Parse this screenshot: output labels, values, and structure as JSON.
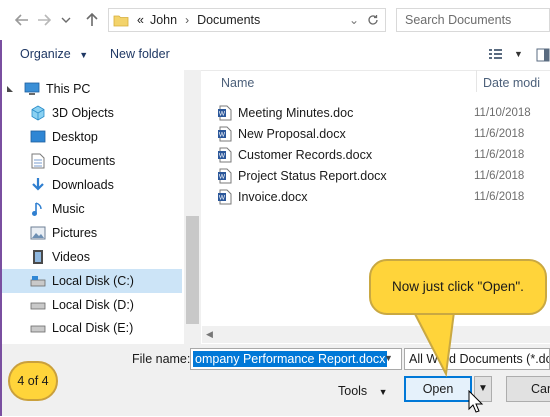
{
  "address": {
    "overflow": "«",
    "crumbs": [
      "John",
      "Documents"
    ],
    "search_placeholder": "Search Documents"
  },
  "toolbar": {
    "organize": "Organize",
    "new_folder": "New folder"
  },
  "nav": [
    {
      "label": "This PC",
      "icon": "pc-icon"
    },
    {
      "label": "3D Objects",
      "icon": "cube-icon"
    },
    {
      "label": "Desktop",
      "icon": "desktop-icon"
    },
    {
      "label": "Documents",
      "icon": "document-icon"
    },
    {
      "label": "Downloads",
      "icon": "download-icon"
    },
    {
      "label": "Music",
      "icon": "music-icon"
    },
    {
      "label": "Pictures",
      "icon": "pictures-icon"
    },
    {
      "label": "Videos",
      "icon": "video-icon"
    },
    {
      "label": "Local Disk (C:)",
      "icon": "drive-icon"
    },
    {
      "label": "Local Disk (D:)",
      "icon": "drive-icon"
    },
    {
      "label": "Local Disk (E:)",
      "icon": "drive-icon"
    }
  ],
  "columns": {
    "name": "Name",
    "date": "Date modi"
  },
  "files": [
    {
      "name": "Meeting Minutes.doc",
      "date": "11/10/2018"
    },
    {
      "name": "New Proposal.docx",
      "date": "11/6/2018"
    },
    {
      "name": "Customer Records.docx",
      "date": "11/6/2018"
    },
    {
      "name": "Project Status Report.docx",
      "date": "11/6/2018"
    },
    {
      "name": "Invoice.docx",
      "date": "11/6/2018"
    }
  ],
  "bottom": {
    "file_name_label": "File name:",
    "file_name_value": "ompany Performance Report.docx",
    "file_type": "All Word Documents (*.doc",
    "tools": "Tools",
    "open": "Open",
    "cancel": "Can"
  },
  "tutorial": {
    "step": "4 of 4",
    "callout": "Now just click \"Open\"."
  },
  "colors": {
    "accent": "#0078d7",
    "callout": "#ffd43a",
    "selected": "#cce4f7"
  }
}
